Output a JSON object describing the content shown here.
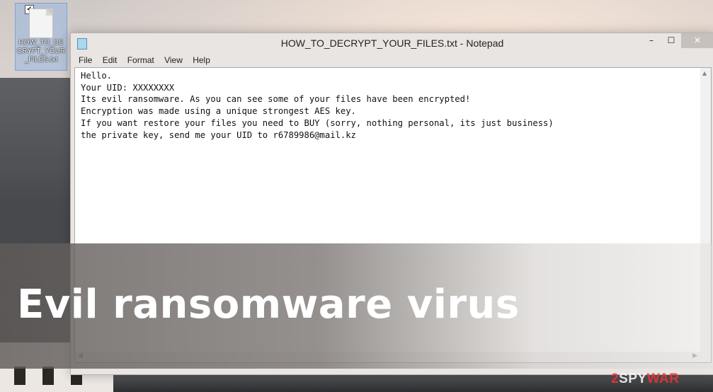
{
  "desktop": {
    "file_icon": {
      "label": "HOW_TO_DECRYPT_YOUR_FILES.txt",
      "checked": true
    }
  },
  "window": {
    "title": "HOW_TO_DECRYPT_YOUR_FILES.txt - Notepad",
    "controls": {
      "minimize": "–",
      "maximize": "☐",
      "close": "✕"
    },
    "menu": [
      "File",
      "Edit",
      "Format",
      "View",
      "Help"
    ],
    "content_lines": [
      "Hello.",
      "Your UID: XXXXXXXX",
      "Its evil ransomware. As you can see some of your files have been encrypted!",
      "Encryption was made using a unique strongest AES key.",
      "If you want restore your files you need to BUY (sorry, nothing personal, its just business)",
      "the private key, send me your UID to r6789986@mail.kz"
    ]
  },
  "overlay": {
    "headline": "Evil ransomware virus",
    "watermark_prefix": "2",
    "watermark_mid": "SPY",
    "watermark_suffix": "WAR"
  },
  "icons": {
    "file": "text-file-icon",
    "notepad": "notepad-icon",
    "scroll_up": "chevron-up-icon",
    "scroll_left": "chevron-left-icon",
    "scroll_right": "chevron-right-icon"
  }
}
